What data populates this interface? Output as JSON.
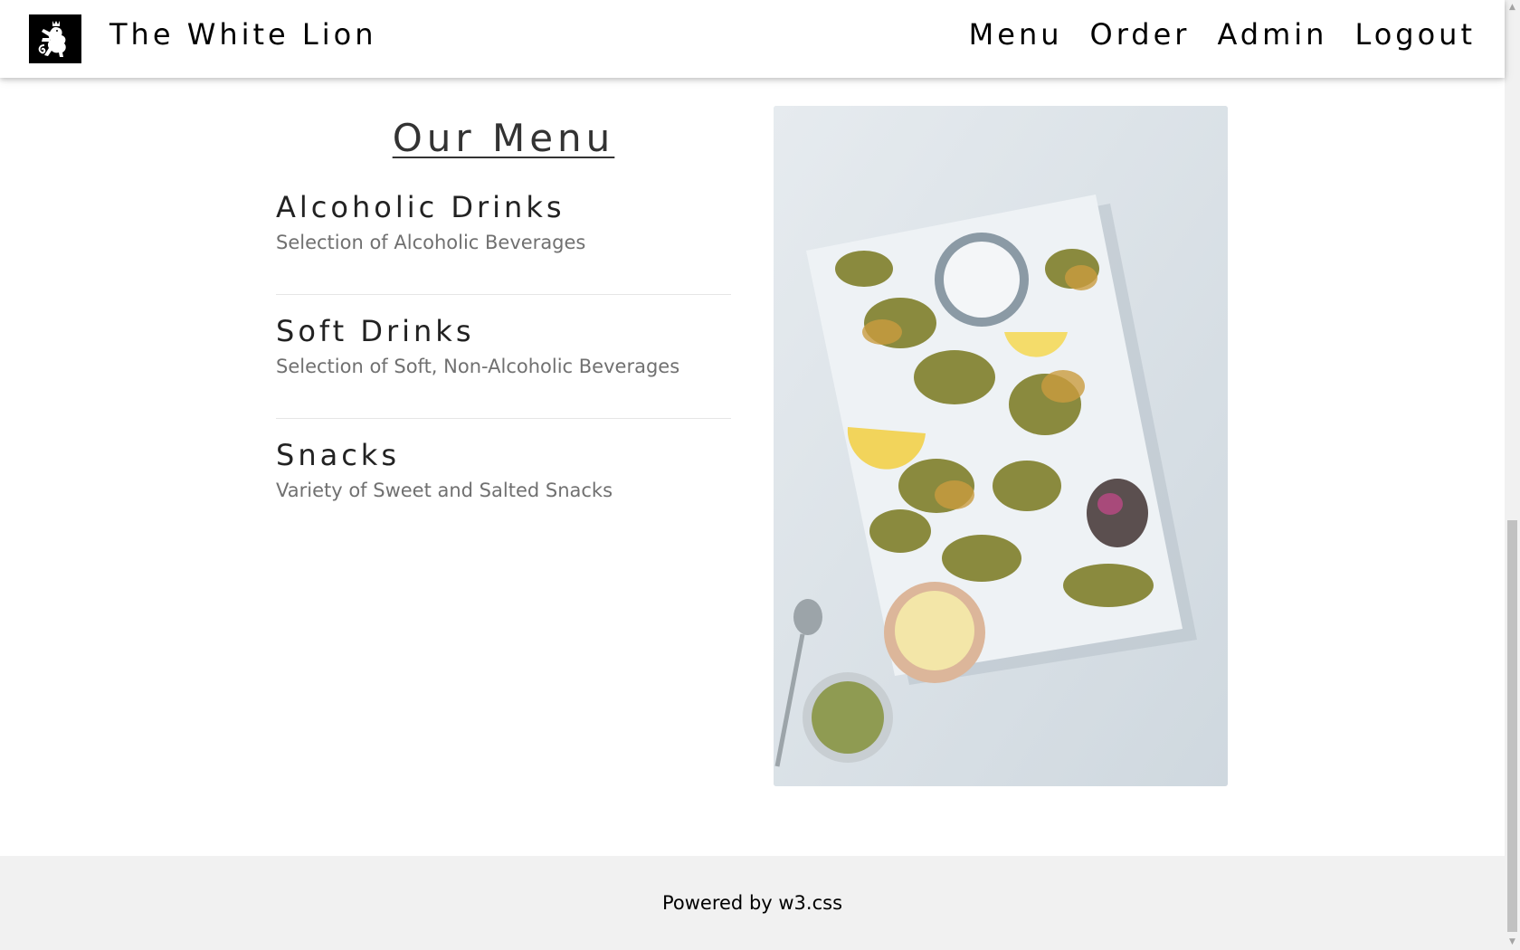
{
  "header": {
    "brand": "The White Lion",
    "logo_icon": "lion-rampant-icon",
    "nav": [
      "Menu",
      "Order",
      "Admin",
      "Logout"
    ]
  },
  "main": {
    "title": "Our Menu",
    "items": [
      {
        "title": "Alcoholic Drinks",
        "description": "Selection of Alcoholic Beverages"
      },
      {
        "title": "Soft Drinks",
        "description": "Selection of Soft, Non-Alcoholic Beverages"
      },
      {
        "title": "Snacks",
        "description": "Variety of Sweet and Salted Snacks"
      }
    ],
    "image_icon": "food-platter-photo"
  },
  "footer": {
    "text": "Powered by w3.css"
  },
  "colors": {
    "navbar_bg": "#ffffff",
    "footer_bg": "#f1f1f1",
    "logo_bg": "#000000",
    "description_text": "#707070"
  }
}
